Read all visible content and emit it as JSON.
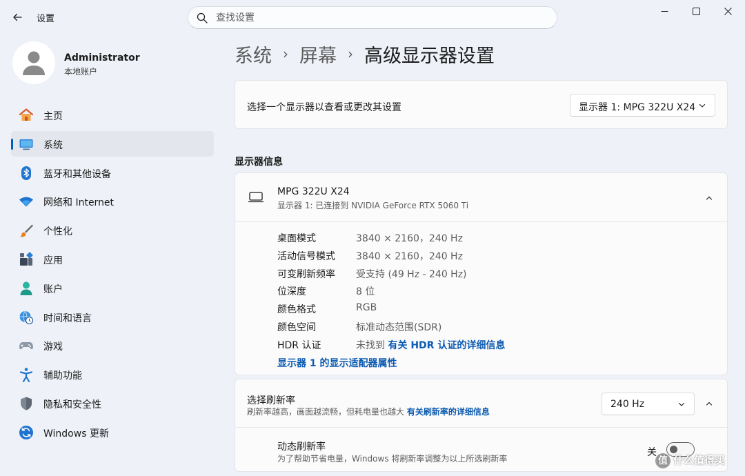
{
  "window": {
    "title": "设置",
    "controls": [
      "minimize-icon",
      "maximize-icon",
      "close-icon"
    ]
  },
  "search": {
    "placeholder": "查找设置",
    "value": ""
  },
  "profile": {
    "name": "Administrator",
    "account_type": "本地账户"
  },
  "sidebar": {
    "items": [
      {
        "label": "主页",
        "icon": "home-icon",
        "selected": false
      },
      {
        "label": "系统",
        "icon": "system-icon",
        "selected": true
      },
      {
        "label": "蓝牙和其他设备",
        "icon": "bluetooth-icon",
        "selected": false
      },
      {
        "label": "网络和 Internet",
        "icon": "wifi-icon",
        "selected": false
      },
      {
        "label": "个性化",
        "icon": "brush-icon",
        "selected": false
      },
      {
        "label": "应用",
        "icon": "apps-icon",
        "selected": false
      },
      {
        "label": "账户",
        "icon": "account-icon",
        "selected": false
      },
      {
        "label": "时间和语言",
        "icon": "globe-clock-icon",
        "selected": false
      },
      {
        "label": "游戏",
        "icon": "gamepad-icon",
        "selected": false
      },
      {
        "label": "辅助功能",
        "icon": "accessibility-icon",
        "selected": false
      },
      {
        "label": "隐私和安全性",
        "icon": "shield-icon",
        "selected": false
      },
      {
        "label": "Windows 更新",
        "icon": "update-icon",
        "selected": false
      }
    ]
  },
  "breadcrumb": {
    "items": [
      "系统",
      "屏幕"
    ],
    "current": "高级显示器设置"
  },
  "monitor_select": {
    "label": "选择一个显示器以查看或更改其设置",
    "value": "显示器 1: MPG 322U X24"
  },
  "display_info": {
    "section_title": "显示器信息",
    "monitor_name": "MPG 322U X24",
    "connection": "显示器 1: 已连接到 NVIDIA GeForce RTX 5060 Ti",
    "rows": [
      {
        "key": "桌面模式",
        "value": "3840 × 2160，240 Hz"
      },
      {
        "key": "活动信号模式",
        "value": "3840 × 2160，240 Hz"
      },
      {
        "key": "可变刷新频率",
        "value": "受支持 (49 Hz - 240 Hz)"
      },
      {
        "key": "位深度",
        "value": "8 位"
      },
      {
        "key": "颜色格式",
        "value": "RGB"
      },
      {
        "key": "颜色空间",
        "value": "标准动态范围(SDR)"
      }
    ],
    "hdr": {
      "key": "HDR 认证",
      "value": "未找到",
      "link": "有关 HDR 认证的详细信息"
    },
    "adapter_link": "显示器 1 的显示适配器属性"
  },
  "refresh_rate": {
    "title": "选择刷新率",
    "description": "刷新率越高，画面越流畅，但耗电量也越大",
    "link": "有关刷新率的详细信息",
    "value": "240 Hz"
  },
  "dynamic_refresh": {
    "title": "动态刷新率",
    "description": "为了帮助节省电量，Windows 将刷新率调整为以上所选刷新率",
    "state_label": "关",
    "enabled": false
  },
  "watermark": {
    "glyph": "值",
    "text": "什么值得买"
  },
  "colors": {
    "accent": "#005fb8",
    "link": "#0d5bb0",
    "background": "#eef2f8",
    "card": "#fbfbfc"
  }
}
